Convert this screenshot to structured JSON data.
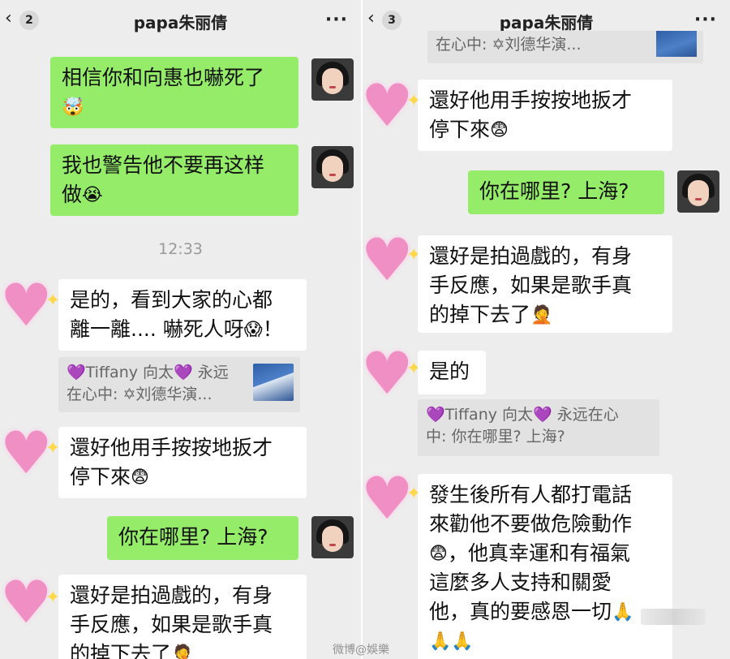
{
  "left": {
    "header": {
      "back_count": "2",
      "title": "papa朱丽倩",
      "more": "···"
    },
    "timestamp": "12:33",
    "messages": {
      "m1": {
        "line1": "相信你和向惠也嚇死了",
        "emoji": "🤯"
      },
      "m2": {
        "line1": "我也警告他不要再这样",
        "line2": "做",
        "emoji": "😭"
      },
      "m3": {
        "line1": "是的，看到大家的心都",
        "line2": "離一離.... 嚇死人呀",
        "emoji": "😱",
        "tail": "！"
      },
      "m3_quote": {
        "line1": "💜Tiffany 向太💜 永远",
        "line2": "在心中: ✡刘德华演..."
      },
      "m4": {
        "line1": "還好他用手按按地扳才",
        "line2": "停下來",
        "emoji": "😨"
      },
      "m5": {
        "text": "你在哪里? 上海?"
      },
      "m6": {
        "line1": "還好是拍過戲的，有身",
        "line2": "手反應，如果是歌手真",
        "line3": "的掉下去了",
        "emoji": "🤦"
      }
    }
  },
  "right": {
    "header": {
      "back_count": "3",
      "title": "papa朱丽倩",
      "more": "···"
    },
    "top_quote": "在心中: ✡刘德华演...",
    "messages": {
      "m1": {
        "line1": "還好他用手按按地扳才",
        "line2": "停下來",
        "emoji": "😨"
      },
      "m2": {
        "text": "你在哪里? 上海?"
      },
      "m3": {
        "line1": "還好是拍過戲的，有身",
        "line2": "手反應，如果是歌手真",
        "line3": "的掉下去了",
        "emoji": "🤦"
      },
      "m4": {
        "text": "是的"
      },
      "m4_quote": {
        "line1": "💜Tiffany 向太💜 永远在心",
        "line2": "中: 你在哪里? 上海?"
      },
      "m5": {
        "line1": "發生後所有人都打電話",
        "line2": "來勸他不要做危險動作",
        "line3": "，他真幸運和有福氣",
        "line4": "這麼多人支持和關愛",
        "line5": "他，真的要感恩一切",
        "emoji1": "😨",
        "emoji2": "🙏",
        "emoji3": "🙏🙏"
      }
    }
  },
  "watermark": "微博@娛樂"
}
